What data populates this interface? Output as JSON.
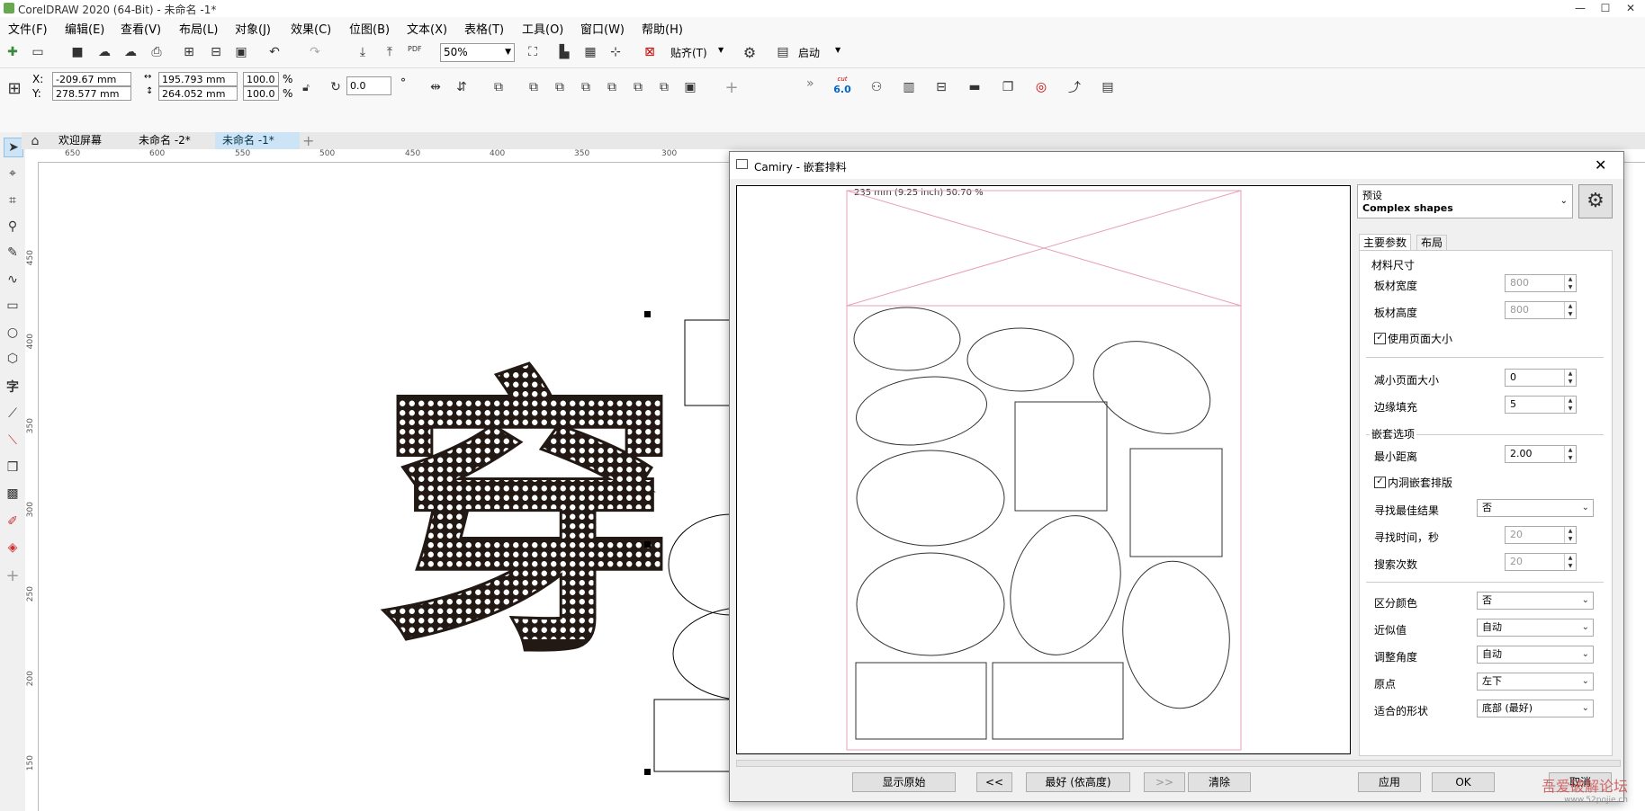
{
  "window": {
    "title": "CorelDRAW 2020 (64-Bit) - 未命名 -1*"
  },
  "menu": [
    "文件(F)",
    "编辑(E)",
    "查看(V)",
    "布局(L)",
    "对象(J)",
    "效果(C)",
    "位图(B)",
    "文本(X)",
    "表格(T)",
    "工具(O)",
    "窗口(W)",
    "帮助(H)"
  ],
  "toolbar": {
    "zoom": "50%",
    "snap_label": "贴齐(T)",
    "launch_label": "启动",
    "pdf_label": "PDF",
    "cut_label": "cut",
    "cut_version": "6.0"
  },
  "propbar": {
    "x_label": "X:",
    "x_value": "-209.67 mm",
    "y_label": "Y:",
    "y_value": "278.577 mm",
    "w_value": "195.793 mm",
    "h_value": "264.052 mm",
    "sx_value": "100.0",
    "sy_value": "100.0",
    "pct": "%",
    "angle_value": "0.0",
    "deg": "°",
    "overflow": "»"
  },
  "tabs": [
    "欢迎屏幕",
    "未命名 -2*",
    "未命名 -1*"
  ],
  "ruler": {
    "h": [
      "650",
      "600",
      "550",
      "500",
      "450",
      "400",
      "350",
      "300"
    ],
    "v": [
      "450",
      "400",
      "350",
      "300",
      "250",
      "200",
      "150"
    ]
  },
  "canvas": {
    "glyph": "穿"
  },
  "dialog": {
    "title": "Camiry - 嵌套排料",
    "preview_info": "235 mm (9.25 inch)  50.70 %",
    "preset_label": "预设",
    "preset_value": "Complex shapes",
    "tabs": [
      "主要参数",
      "布局"
    ],
    "groups": {
      "material": "材料尺寸",
      "nesting": "嵌套选项"
    },
    "fields": {
      "sheet_width": {
        "label": "板材宽度",
        "value": "800"
      },
      "sheet_height": {
        "label": "板材高度",
        "value": "800"
      },
      "use_page_size": {
        "label": "使用页面大小",
        "checked": true
      },
      "reduce_page": {
        "label": "减小页面大小",
        "value": "0"
      },
      "margin": {
        "label": "边缘填充",
        "value": "5"
      },
      "min_distance": {
        "label": "最小距离",
        "value": "2.00"
      },
      "hole_nesting": {
        "label": "内洞嵌套排版",
        "checked": true
      },
      "find_best": {
        "label": "寻找最佳结果",
        "value": "否"
      },
      "search_time": {
        "label": "寻找时间，秒",
        "value": "20"
      },
      "search_count": {
        "label": "搜索次数",
        "value": "20"
      },
      "distinguish_color": {
        "label": "区分颜色",
        "value": "否"
      },
      "approx": {
        "label": "近似值",
        "value": "自动"
      },
      "adjust_angle": {
        "label": "调整角度",
        "value": "自动"
      },
      "origin": {
        "label": "原点",
        "value": "左下"
      },
      "fit_shape": {
        "label": "适合的形状",
        "value": "底部 (最好)"
      }
    },
    "buttons": {
      "show_original": "显示原始",
      "prev": "<<",
      "best": "最好 (依高度)",
      "next": ">>",
      "clear": "清除",
      "apply": "应用",
      "ok": "OK",
      "cancel": "取消"
    }
  },
  "watermark": {
    "text": "吾爱破解论坛",
    "url": "www.52pojie.cn"
  },
  "colors": {
    "pink": "#e8a0b4",
    "accent": "#0078d7"
  }
}
